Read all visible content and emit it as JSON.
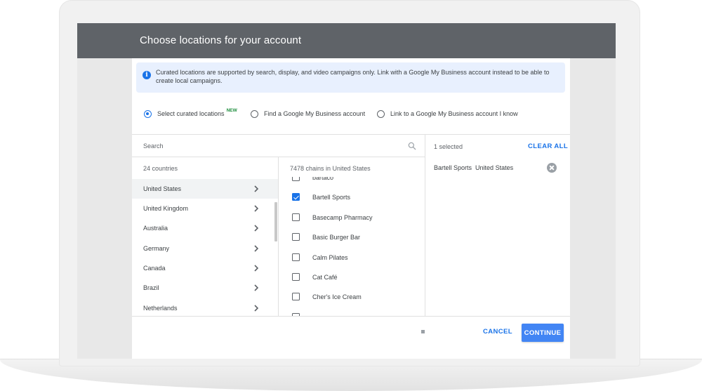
{
  "header": {
    "title": "Choose locations for your account"
  },
  "banner": {
    "text": "Curated locations are supported by search, display, and video campaigns only. Link with a Google My Business account instead to be able to create local campaigns."
  },
  "options": [
    {
      "label": "Select curated locations",
      "badge": "NEW",
      "selected": true
    },
    {
      "label": "Find a Google My Business account",
      "selected": false
    },
    {
      "label": "Link to a Google My Business account I know",
      "selected": false
    }
  ],
  "search": {
    "placeholder": "Search"
  },
  "countries": {
    "heading": "24 countries",
    "items": [
      "United States",
      "United Kingdom",
      "Australia",
      "Germany",
      "Canada",
      "Brazil",
      "Netherlands"
    ],
    "active": "United States"
  },
  "chains": {
    "heading": "7478 chains in United States",
    "items": [
      {
        "name": "bartaco",
        "checked": false
      },
      {
        "name": "Bartell Sports",
        "checked": true
      },
      {
        "name": "Basecamp Pharmacy",
        "checked": false
      },
      {
        "name": "Basic Burger Bar",
        "checked": false
      },
      {
        "name": "Calm Pilates",
        "checked": false
      },
      {
        "name": "Cat Café",
        "checked": false
      },
      {
        "name": "Cher's Ice Cream",
        "checked": false
      }
    ]
  },
  "selection": {
    "count_label": "1 selected",
    "clear_label": "CLEAR ALL",
    "items": [
      {
        "name": "Bartell Sports",
        "country": "United States"
      }
    ]
  },
  "footer": {
    "cancel_label": "CANCEL",
    "continue_label": "CONTINUE"
  },
  "colors": {
    "accent": "#1a73e8",
    "header": "#5f6368",
    "banner": "#e8f0fe",
    "button": "#4285f4",
    "new_badge": "#1e8e3e"
  }
}
